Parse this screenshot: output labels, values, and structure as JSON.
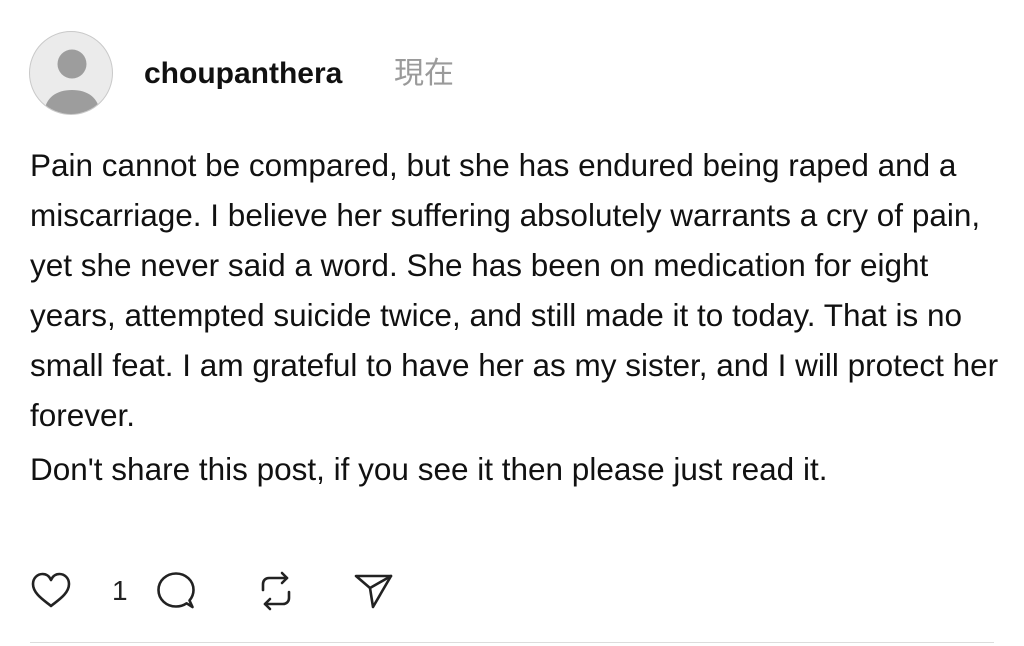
{
  "post": {
    "author": {
      "username": "choupanthera",
      "avatar_icon": "default-user-avatar-icon"
    },
    "timestamp": "現在",
    "paragraphs": [
      "Pain cannot be compared, but she has endured being raped and a miscarriage. I believe her suffering absolutely warrants a cry of pain, yet she never said a word. She has been on medication for eight years, attempted suicide twice, and still made it to today. That is no small feat. I am grateful to have her as my sister, and I will protect her forever.",
      "Don't share this post, if you see it then please just read it."
    ],
    "actions": {
      "like_icon": "heart-icon",
      "like_count": "1",
      "reply_icon": "comment-bubble-icon",
      "repost_icon": "repost-icon",
      "share_icon": "send-icon"
    }
  },
  "colors": {
    "text": "#111111",
    "muted": "#9a9a9a",
    "avatar_bg": "#ebebeb",
    "avatar_figure": "#9d9d9d",
    "divider": "#dcdcdc"
  }
}
